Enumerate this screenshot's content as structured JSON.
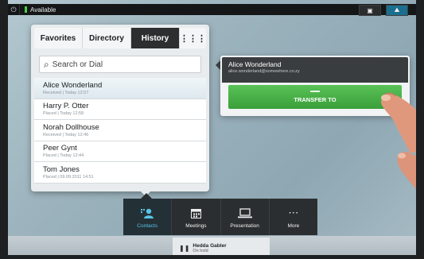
{
  "topbar": {
    "status": "Available"
  },
  "panel": {
    "tabs": [
      "Favorites",
      "Directory",
      "History"
    ],
    "search_placeholder": "Search or Dial",
    "history": [
      {
        "name": "Alice Wonderland",
        "meta": "Received | Today 12:57"
      },
      {
        "name": "Harry P. Otter",
        "meta": "Placed | Today 12:58"
      },
      {
        "name": "Norah Dollhouse",
        "meta": "Received | Today 12:46"
      },
      {
        "name": "Peer Gynt",
        "meta": "Placed | Today 12:44"
      },
      {
        "name": "Tom Jones",
        "meta": "Placed | 09.09.2011 14:51"
      }
    ]
  },
  "card": {
    "name": "Alice Wonderland",
    "email": "alice.wonderland@somewhere.co.zy",
    "transfer_label": "TRANSFER TO"
  },
  "dock": {
    "items": [
      "Contacts",
      "Meetings",
      "Presentation",
      "More"
    ]
  },
  "hold": {
    "name": "Hedda Gabler",
    "status": "On hold"
  },
  "colors": {
    "accent_green": "#47b846",
    "accent_blue": "#58c4e7"
  }
}
